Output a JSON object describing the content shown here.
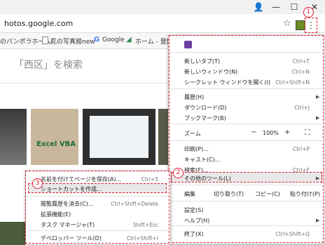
{
  "window": {
    "minimize": "—",
    "maximize": "☐",
    "close": "✕",
    "account": "👤"
  },
  "address": {
    "url": "hotos.google.com",
    "star": "☆",
    "menu": "⋮"
  },
  "bookmarks": [
    {
      "label": "のパンポラホーム/"
    },
    {
      "label": "花の写真館new"
    },
    {
      "label": "Google"
    },
    {
      "label": "ホーム - 登録"
    }
  ],
  "page": {
    "search_text": "「西区」を検索",
    "excel_label": "Excel VBA"
  },
  "main_menu": {
    "items": [
      {
        "label": "新しいタブ(T)",
        "shortcut": "Ctrl+T"
      },
      {
        "label": "新しいウィンドウ(N)",
        "shortcut": "Ctrl+N"
      },
      {
        "label": "シークレット ウィンドウを開く(I)",
        "shortcut": "Ctrl+Shift+N"
      },
      {
        "label": "履歴(H)",
        "shortcut": ""
      },
      {
        "label": "ダウンロード(D)",
        "shortcut": "Ctrl+J"
      },
      {
        "label": "ブックマーク(B)",
        "shortcut": ""
      },
      {
        "label": "印刷(P)...",
        "shortcut": "Ctrl+P"
      },
      {
        "label": "キャスト(C)...",
        "shortcut": ""
      },
      {
        "label": "検索(F)...",
        "shortcut": "Ctrl+F"
      },
      {
        "label": "その他のツール(L)",
        "shortcut": ""
      },
      {
        "label": "設定(S)",
        "shortcut": ""
      },
      {
        "label": "ヘルプ(H)",
        "shortcut": ""
      },
      {
        "label": "終了(X)",
        "shortcut": "Ctrl+Shift+Q"
      }
    ],
    "zoom": {
      "label": "ズーム",
      "minus": "−",
      "value": "100%",
      "plus": "+",
      "fullscreen": "⛶"
    },
    "edit": {
      "label": "編集",
      "cut": "切り取り(T)",
      "copy": "コピー(C)",
      "paste": "貼り付け(P)"
    }
  },
  "submenu": {
    "items": [
      {
        "label": "名前を付けてページを保存(A)...",
        "shortcut": "Ctrl+S"
      },
      {
        "label": "ショートカットを作成...",
        "shortcut": ""
      },
      {
        "label": "閲覧履歴を消去(C)...",
        "shortcut": "Ctrl+Shift+Delete"
      },
      {
        "label": "拡張機能(E)",
        "shortcut": ""
      },
      {
        "label": "タスク マネージャ(T)",
        "shortcut": "Shift+Esc"
      },
      {
        "label": "デベロッパー ツール(D)",
        "shortcut": "Ctrl+Shift+I"
      }
    ]
  },
  "annotations": {
    "step1": "1",
    "step2": "2",
    "step3": "3"
  },
  "colors": {
    "annotation": "#e0182d",
    "menu_background": "#ffffff"
  }
}
